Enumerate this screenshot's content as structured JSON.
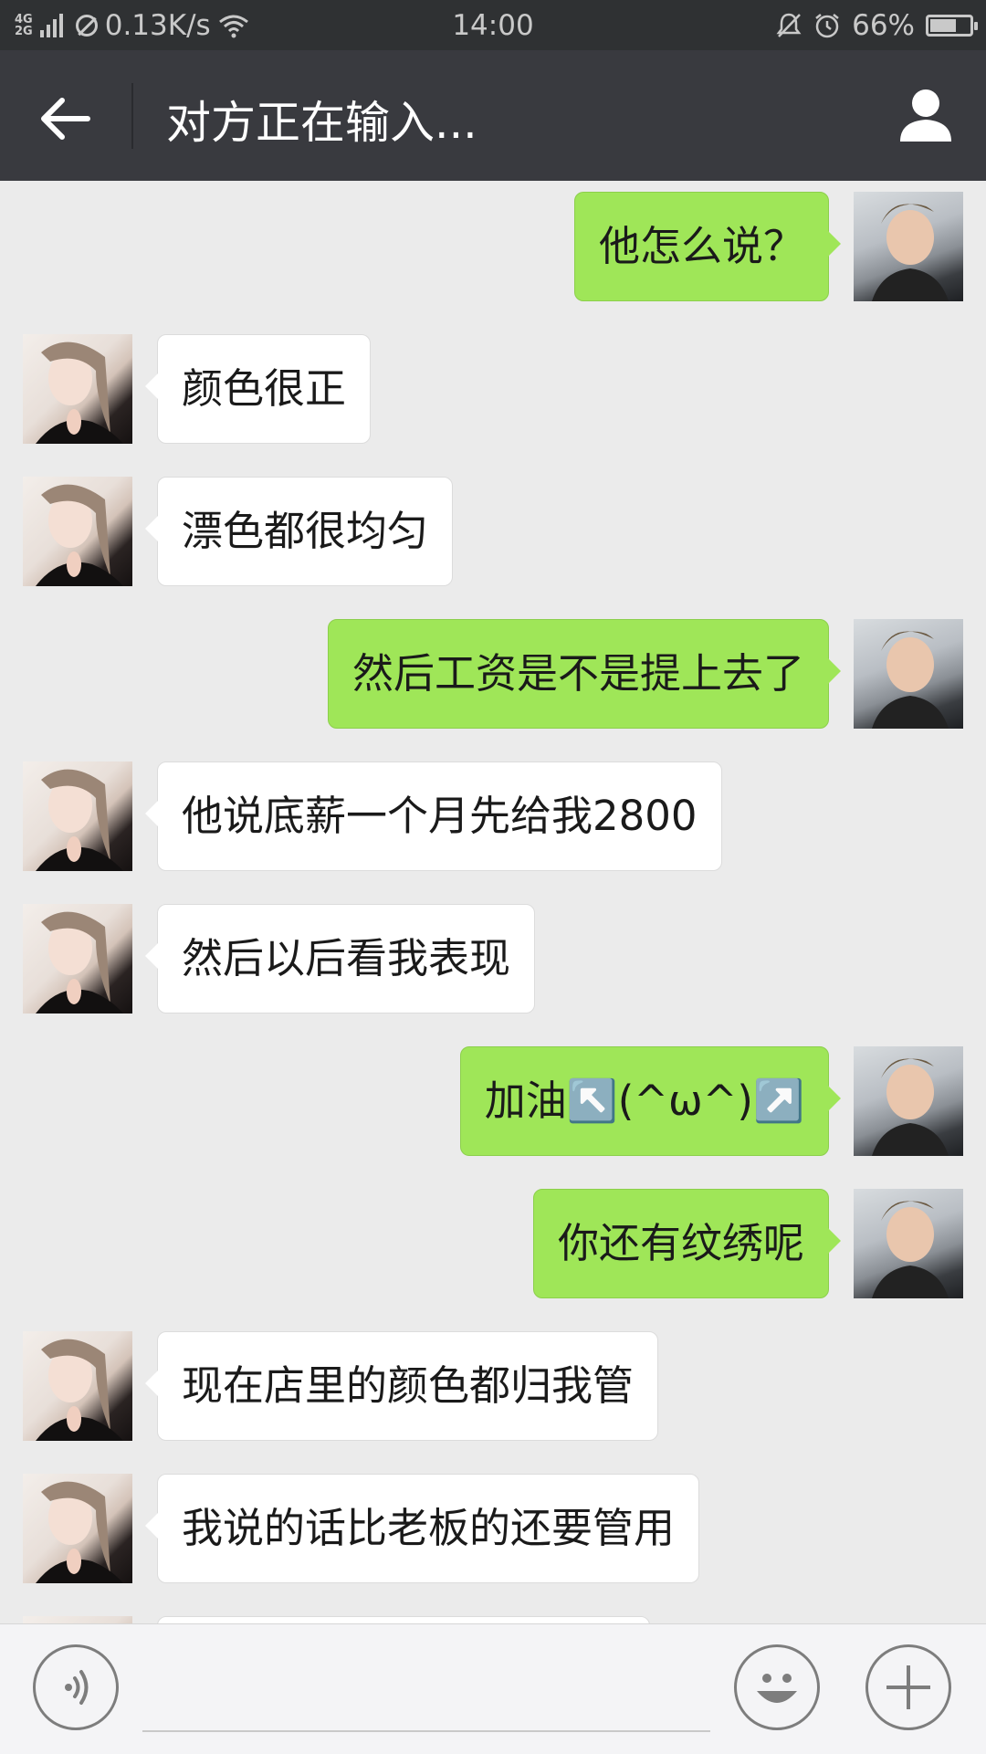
{
  "status_bar": {
    "network_type_top": "4G",
    "network_type_bottom": "2G",
    "speed": "0.13K/s",
    "time": "14:00",
    "battery_percent": "66%",
    "battery_level": 0.66
  },
  "header": {
    "back_icon": "arrow-left-icon",
    "title": "对方正在输入...",
    "contact_icon": "person-icon"
  },
  "messages": [
    {
      "direction": "out",
      "text": "他怎么说？"
    },
    {
      "direction": "in",
      "text": "颜色很正"
    },
    {
      "direction": "in",
      "text": "漂色都很均匀"
    },
    {
      "direction": "out",
      "text": "然后工资是不是提上去了"
    },
    {
      "direction": "in",
      "text": "他说底薪一个月先给我2800"
    },
    {
      "direction": "in",
      "text": "然后以后看我表现"
    },
    {
      "direction": "out",
      "text": "加油↖️(^ω^)↗️"
    },
    {
      "direction": "out",
      "text": "你还有纹绣呢"
    },
    {
      "direction": "in",
      "text": "现在店里的颜色都归我管"
    },
    {
      "direction": "in",
      "text": "我说的话比老板的还要管用"
    }
  ],
  "input_bar": {
    "voice_icon": "voice-icon",
    "emoji_icon": "smiley-icon",
    "plus_icon": "plus-icon",
    "text_value": ""
  },
  "colors": {
    "outgoing_bubble": "#9fe658",
    "incoming_bubble": "#ffffff",
    "chat_background": "#ebebeb",
    "title_bar": "#393a3f"
  }
}
